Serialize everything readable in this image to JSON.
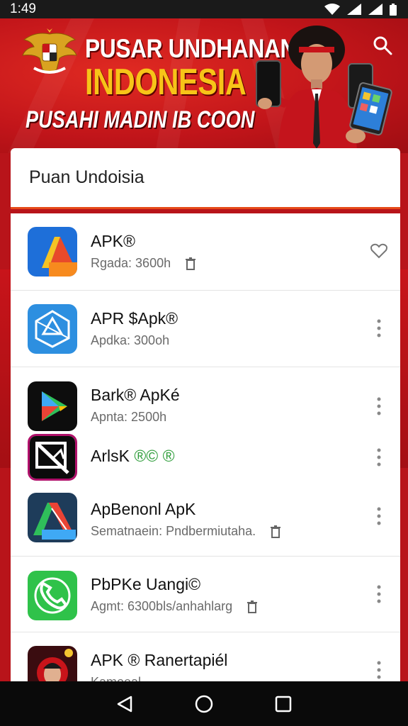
{
  "status_bar": {
    "time": "1:49",
    "icons": [
      "wifi-icon",
      "signal-icon",
      "signal-icon-2",
      "battery-icon"
    ]
  },
  "banner": {
    "title_line1": "PUSAR UNDHANAN",
    "title_line2": "INDONESIA",
    "subtitle": "PUSAHI MADIN IB COON",
    "colors": {
      "background": "#c2151a",
      "title1": "#ffffff",
      "title2": "#f7c418"
    }
  },
  "search": {
    "text": "Puan Undoisia",
    "accent": "#e64a19"
  },
  "apps": [
    {
      "title": "APK®",
      "subtitle": "Rgada: 3600h",
      "action_icon": "heart-icon"
    },
    {
      "title": "APR $Apk®",
      "subtitle": "Apdka: 300oh",
      "action_icon": "more-vert-icon"
    },
    {
      "title": "Bark® ApKé",
      "subtitle": "Apnta: 2500h",
      "action_icon": "more-vert-icon"
    },
    {
      "title": "ArlsK",
      "title_badge": "®© ®",
      "subtitle": "",
      "action_icon": "more-vert-icon"
    },
    {
      "title": "ApBenonl ApK",
      "subtitle": "Sematnaein: Pndbermiutaha.",
      "action_icon": "more-vert-icon"
    },
    {
      "title": "PbPKe Uangi©",
      "subtitle": "Agmt: 6300bls/anhahlarg",
      "action_icon": "more-vert-icon"
    },
    {
      "title": "APK ® Ranertapiél",
      "subtitle": "Kamoeal",
      "action_icon": "more-vert-icon"
    }
  ],
  "nav": {
    "icons": [
      "back-icon",
      "home-icon",
      "recents-icon"
    ]
  }
}
